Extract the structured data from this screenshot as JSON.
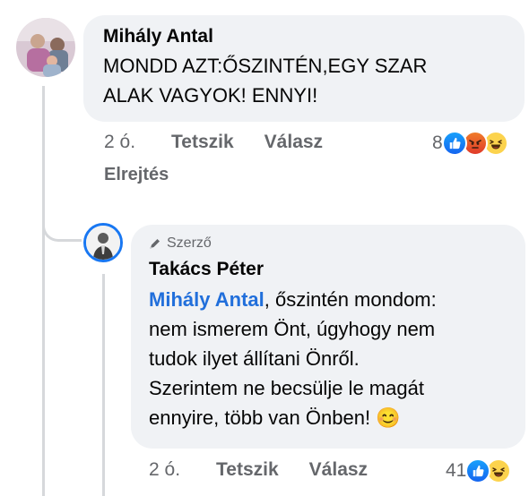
{
  "comment": {
    "author": "Mihály Antal",
    "text_line1": "MONDD AZT:ŐSZINTÉN,EGY SZAR",
    "text_line2": "ALAK VAGYOK! ENNYI!",
    "time": "2 ó.",
    "like_label": "Tetszik",
    "reply_label": "Válasz",
    "reaction_count": "8",
    "reactions": [
      "like-icon",
      "angry-icon",
      "haha-icon"
    ],
    "hide_label": "Elrejtés"
  },
  "reply": {
    "badge": "Szerző",
    "author": "Takács Péter",
    "mention": "Mihály Antal",
    "text_line1_rest": ", őszintén mondom:",
    "text_line2": "nem ismerem Önt, úgyhogy nem",
    "text_line3": "tudok ilyet állítani Önről.",
    "text_line4": "Szerintem ne becsülje le magát",
    "text_line5": "ennyire, több van Önben! 😊",
    "time": "2 ó.",
    "like_label": "Tetszik",
    "reply_label": "Válasz",
    "reaction_count": "41",
    "reactions": [
      "like-icon",
      "haha-icon"
    ]
  },
  "colors": {
    "bubble_bg": "#f0f2f5",
    "mention": "#216fdb",
    "secondary_text": "#65676b",
    "author_ring": "#1877f2"
  }
}
